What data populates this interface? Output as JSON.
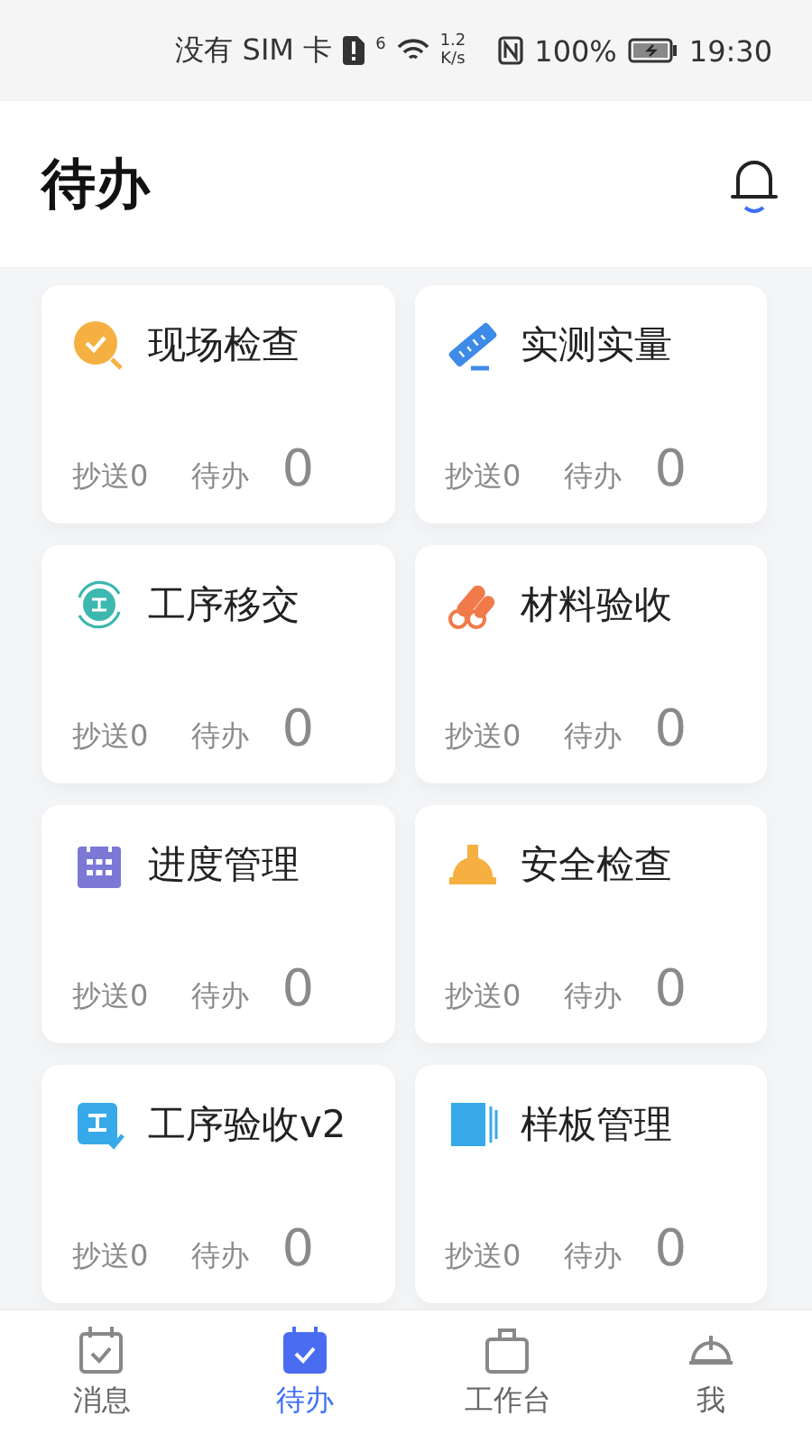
{
  "status_bar": {
    "carrier": "没有 SIM 卡",
    "network_type": "6",
    "speed": "1.2",
    "speed_unit": "K/s",
    "battery": "100%",
    "time": "19:30"
  },
  "header": {
    "title": "待办"
  },
  "cards": [
    {
      "title": "现场检查",
      "cc_label": "抄送0",
      "todo_label": "待办",
      "count": "0"
    },
    {
      "title": "实测实量",
      "cc_label": "抄送0",
      "todo_label": "待办",
      "count": "0"
    },
    {
      "title": "工序移交",
      "cc_label": "抄送0",
      "todo_label": "待办",
      "count": "0"
    },
    {
      "title": "材料验收",
      "cc_label": "抄送0",
      "todo_label": "待办",
      "count": "0"
    },
    {
      "title": "进度管理",
      "cc_label": "抄送0",
      "todo_label": "待办",
      "count": "0"
    },
    {
      "title": "安全检查",
      "cc_label": "抄送0",
      "todo_label": "待办",
      "count": "0"
    },
    {
      "title": "工序验收v2",
      "cc_label": "抄送0",
      "todo_label": "待办",
      "count": "0"
    },
    {
      "title": "样板管理",
      "cc_label": "抄送0",
      "todo_label": "待办",
      "count": "0"
    }
  ],
  "tab_bar": [
    {
      "label": "消息",
      "selected": false
    },
    {
      "label": "待办",
      "selected": true
    },
    {
      "label": "工作台",
      "selected": false
    },
    {
      "label": "我",
      "selected": false
    }
  ]
}
